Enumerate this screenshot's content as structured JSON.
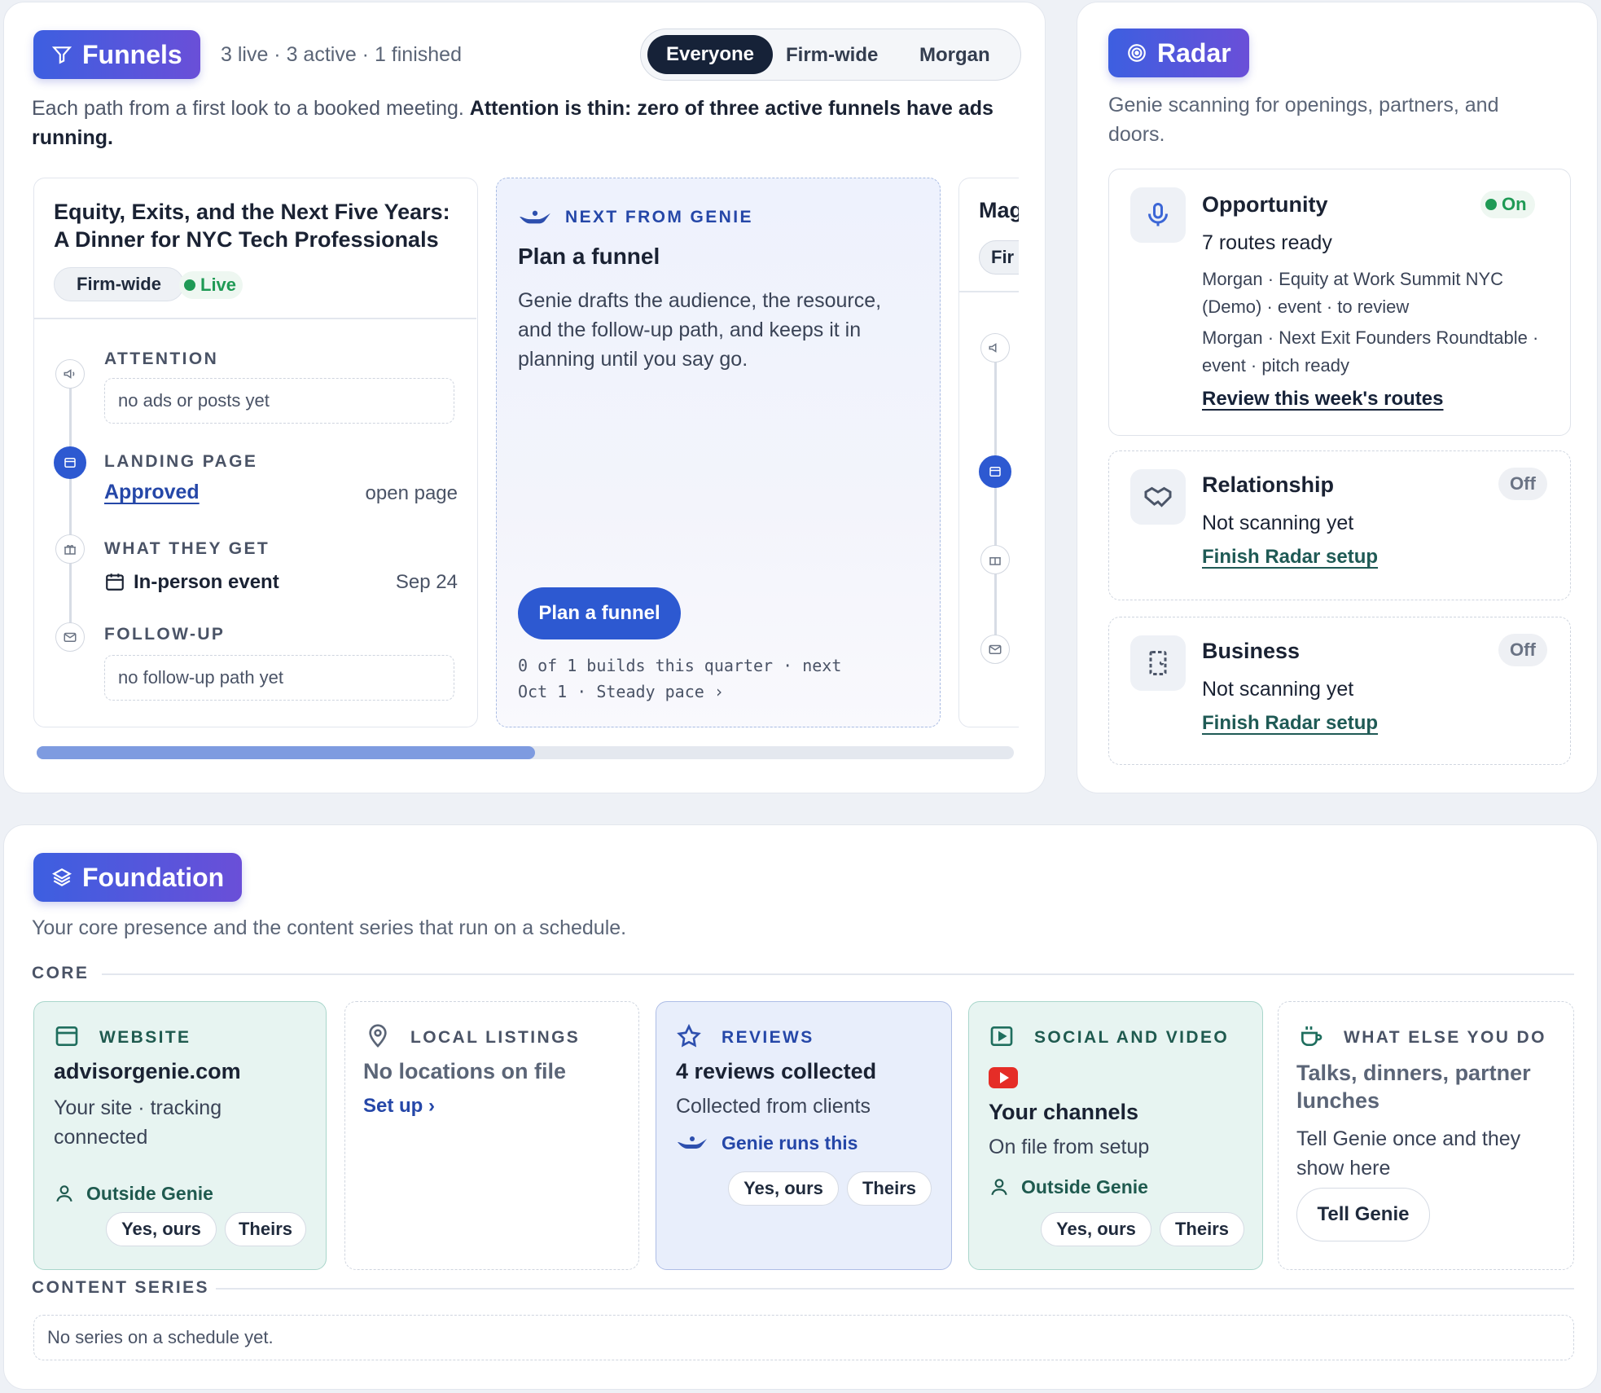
{
  "funnels": {
    "title": "Funnels",
    "stats": "3 live · 3 active · 1 finished",
    "filters": [
      "Everyone",
      "Firm-wide",
      "Morgan"
    ],
    "desc_plain": "Each path from a first look to a booked meeting. ",
    "desc_bold": "Attention is thin: zero of three active funnels have ads running.",
    "card1": {
      "title": "Equity, Exits, and the Next Five Years: A Dinner for NYC Tech Professionals",
      "tag": "Firm-wide",
      "status": "Live",
      "attention_label": "ATTENTION",
      "attention_value": "no ads or posts yet",
      "landing_label": "LANDING PAGE",
      "landing_value": "Approved",
      "landing_action": "open page",
      "get_label": "WHAT THEY GET",
      "get_value": "In-person event",
      "get_date": "Sep 24",
      "follow_label": "FOLLOW-UP",
      "follow_value": "no follow-up path yet"
    },
    "genie": {
      "eyebrow": "NEXT FROM GENIE",
      "title": "Plan a funnel",
      "body": "Genie drafts the audience, the resource, and the follow-up path, and keeps it in planning until you say go.",
      "button": "Plan a funnel",
      "meta1": "0 of 1 builds this quarter · next",
      "meta2": "Oct 1 · Steady pace ›"
    },
    "card3": {
      "title": "Mag",
      "tag": "Fir"
    },
    "scroll_progress": 0.51
  },
  "radar": {
    "title": "Radar",
    "desc": "Genie scanning for openings, partners, and doors.",
    "opportunity": {
      "title": "Opportunity",
      "status": "On",
      "subtitle": "7 routes ready",
      "item1": "Morgan · Equity at Work Summit NYC (Demo) · event · to review",
      "item2": "Morgan · Next Exit Founders Roundtable · event · pitch ready",
      "link": "Review this week's routes"
    },
    "relationship": {
      "title": "Relationship",
      "status": "Off",
      "subtitle": "Not scanning yet",
      "link": "Finish Radar setup"
    },
    "business": {
      "title": "Business",
      "status": "Off",
      "subtitle": "Not scanning yet",
      "link": "Finish Radar setup"
    }
  },
  "foundation": {
    "title": "Foundation",
    "desc": "Your core presence and the content series that run on a schedule.",
    "core_label": "CORE",
    "series_label": "CONTENT SERIES",
    "series_empty": "No series on a schedule yet.",
    "website": {
      "label": "WEBSITE",
      "title": "advisorgenie.com",
      "body": "Your site · tracking connected",
      "owner": "Outside Genie",
      "yes": "Yes, ours",
      "theirs": "Theirs"
    },
    "listings": {
      "label": "LOCAL LISTINGS",
      "title": "No locations on file",
      "link": "Set up ›"
    },
    "reviews": {
      "label": "REVIEWS",
      "title": "4 reviews collected",
      "body": "Collected from clients",
      "owner": "Genie runs this",
      "yes": "Yes, ours",
      "theirs": "Theirs"
    },
    "social": {
      "label": "SOCIAL AND VIDEO",
      "title": "Your channels",
      "body": "On file from setup",
      "owner": "Outside Genie",
      "yes": "Yes, ours",
      "theirs": "Theirs"
    },
    "else": {
      "label": "WHAT ELSE YOU DO",
      "title": "Talks, dinners, partner lunches",
      "body": "Tell Genie once and they show here",
      "button": "Tell Genie"
    }
  },
  "colors": {
    "accent": "#2d59d1",
    "live": "#1f9a55",
    "teal_bg": "#e7f4f1",
    "blue_bg": "#e8eefb"
  }
}
